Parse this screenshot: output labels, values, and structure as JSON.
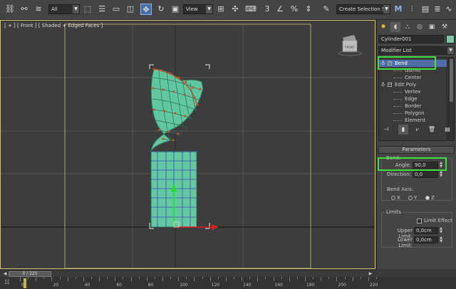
{
  "toolbar": {
    "selection_filter": "All",
    "reference_coord": "View",
    "snap_label": "3",
    "named_selection": "Create Selection Se",
    "icons": [
      "link-icon",
      "unlink-icon",
      "bind-space-warp-icon",
      "select-object-icon",
      "select-by-name-icon",
      "rectangular-selection-icon",
      "window-crossing-icon",
      "select-and-move-icon",
      "select-and-rotate-icon",
      "select-and-scale-icon",
      "use-pivot-icon",
      "select-manipulate-icon",
      "keyboard-shortcut-icon",
      "snap-icon",
      "angle-snap-icon",
      "percent-snap-icon",
      "spinner-snap-icon",
      "edit-named-selection-icon",
      "mirror-icon",
      "align-icon",
      "scene-explorer-icon",
      "layer-explorer-icon",
      "curve-editor-icon"
    ]
  },
  "viewport": {
    "label": "[ + ] [ Front ] [ Shaded + Edged Faces ]",
    "viewcube_label": "FRONT",
    "border_color": "#d4c27a",
    "mesh_color": "#6cd6a8"
  },
  "panel": {
    "tabs": [
      "create-tab-icon",
      "modify-tab-icon",
      "hierarchy-tab-icon",
      "motion-tab-icon",
      "display-tab-icon",
      "utilities-tab-icon"
    ],
    "object_name": "Cylinder001",
    "object_color": "#7ec9a8",
    "modifier_list_label": "Modifier List",
    "stack": [
      {
        "label": "Bend",
        "selected": true,
        "type": "modifier"
      },
      {
        "label": "Gizmo",
        "selected": false,
        "type": "sub"
      },
      {
        "label": "Center",
        "selected": false,
        "type": "sub"
      },
      {
        "label": "Edit Poly",
        "selected": false,
        "type": "modifier"
      },
      {
        "label": "Vertex",
        "selected": false,
        "type": "sub"
      },
      {
        "label": "Edge",
        "selected": false,
        "type": "sub"
      },
      {
        "label": "Border",
        "selected": false,
        "type": "sub"
      },
      {
        "label": "Polygon",
        "selected": false,
        "type": "sub"
      },
      {
        "label": "Element",
        "selected": false,
        "type": "sub"
      }
    ],
    "rollout_title": "Parameters",
    "bend_group_title": "Bend:",
    "angle_label": "Angle:",
    "angle_value": "90,0",
    "direction_label": "Direction:",
    "direction_value": "0,0",
    "bend_axis_title": "Bend Axis:",
    "axes": [
      {
        "label": "X",
        "checked": false
      },
      {
        "label": "Y",
        "checked": false
      },
      {
        "label": "Z",
        "checked": true
      }
    ],
    "limits_title": "Limits",
    "limit_effect_label": "Limit Effect",
    "upper_limit_label": "Upper Limit:",
    "upper_limit_value": "0,0cm",
    "lower_limit_label": "Lower Limit:",
    "lower_limit_value": "0,0cm",
    "highlight_color": "#3de03d"
  },
  "timeline": {
    "frame_display": "0 / 225",
    "ruler_labels": [
      "0",
      "20",
      "40",
      "60",
      "80",
      "100",
      "120",
      "140",
      "160",
      "180",
      "200",
      "220"
    ]
  }
}
